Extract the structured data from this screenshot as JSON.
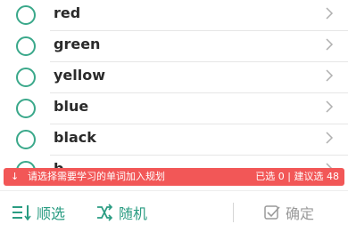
{
  "words": [
    "red",
    "green",
    "yellow",
    "blue",
    "black",
    "b"
  ],
  "banner": {
    "arrow": "↓",
    "message": "请选择需要学习的单词加入规划",
    "count_text": "已选 0 | 建议选 48"
  },
  "toolbar": {
    "order_label": "顺选",
    "random_label": "随机",
    "confirm_label": "确定"
  },
  "colors": {
    "accent": "#3aa88a",
    "banner": "#f25757",
    "disabled": "#9a9a9a"
  }
}
